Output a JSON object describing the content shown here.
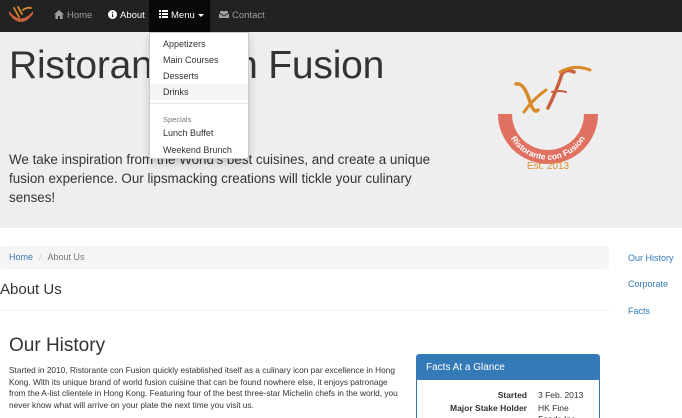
{
  "navbar": {
    "items": [
      {
        "label": "Home",
        "icon": "home-icon"
      },
      {
        "label": "About",
        "icon": "info-icon"
      },
      {
        "label": "Menu",
        "icon": "list-icon"
      },
      {
        "label": "Contact",
        "icon": "envelope-icon"
      }
    ],
    "active": "About",
    "open_dropdown": "Menu"
  },
  "dropdown": {
    "items": [
      "Appetizers",
      "Main Courses",
      "Desserts",
      "Drinks"
    ],
    "highlighted": "Drinks",
    "header": "Specials",
    "specials": [
      "Lunch Buffet",
      "Weekend Brunch"
    ]
  },
  "jumbotron": {
    "title": "Ristorante con Fusion",
    "text": "We take inspiration from the World's best cuisines, and create a unique fusion experience. Our lipsmacking creations will tickle your culinary senses!",
    "logo": {
      "text": "Ristorante con Fusion",
      "est": "Est. 2013"
    }
  },
  "breadcrumb": {
    "home": "Home",
    "current": "About Us"
  },
  "sidenav": [
    "Our History",
    "Corporate",
    "Facts"
  ],
  "page_title": "About Us",
  "history": {
    "title": "Our History",
    "text": "Started in 2010, Ristorante con Fusion quickly established itself as a culinary icon par excellence in Hong Kong. With its unique brand of world fusion cuisine that can be found nowhere else, it enjoys patronage from the A-list clientele in Hong Kong. Featuring four of the best three-star Michelin chefs in the world, you never know what will arrive on your plate the next time you visit us."
  },
  "facts": {
    "title": "Facts At a Glance",
    "rows": [
      {
        "label": "Started",
        "value": "3 Feb. 2013"
      },
      {
        "label": "Major Stake Holder",
        "value": "HK Fine Foods Inc."
      }
    ]
  },
  "colors": {
    "navbar": "#222222",
    "link": "#337ab7",
    "jumbotron": "#eeeeee",
    "logo_arc": "#e07060",
    "logo_text": "#d9534f"
  }
}
